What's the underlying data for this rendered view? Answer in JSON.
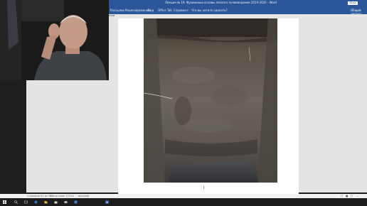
{
  "window": {
    "title": "Лекция № 19. Фузионные основы лесного почвоведения 2019-2020 - Word",
    "sign_in": "Вход"
  },
  "ribbon": {
    "tabs": [
      "Рассылки",
      "Рецензирование",
      "Вид",
      "Office Tab",
      "Справка",
      "Что вы хотите сделать?"
    ],
    "share": "Общий доступ"
  },
  "cmdbar": {
    "style_label": "Стили"
  },
  "status_bar": {
    "page": "Страница 61 из 127",
    "words": "Число слов: 17224",
    "language": "русский"
  },
  "taskbar": {
    "icons": [
      "windows-start-icon",
      "search-icon",
      "task-view-icon",
      "edge-icon",
      "file-explorer-icon",
      "store-icon",
      "mail-icon",
      "photos-icon",
      "word-icon"
    ]
  },
  "colors": {
    "word_blue": "#2b579a",
    "canvas": "#e4e4e4",
    "taskbar": "#1c1c1c"
  }
}
